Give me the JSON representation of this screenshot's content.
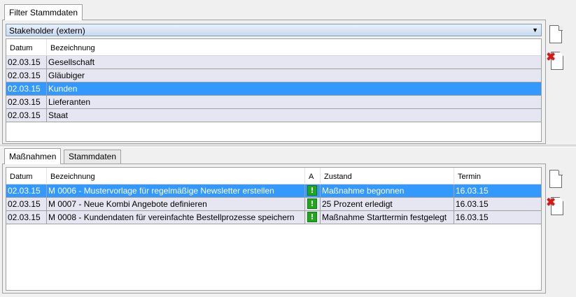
{
  "top_panel": {
    "tab_label": "Filter Stammdaten",
    "filter_value": "Stakeholder (extern)",
    "columns": [
      "Datum",
      "Bezeichnung"
    ],
    "rows": [
      {
        "datum": "02.03.15",
        "bezeichnung": "Gesellschaft"
      },
      {
        "datum": "02.03.15",
        "bezeichnung": "Gläubiger"
      },
      {
        "datum": "02.03.15",
        "bezeichnung": "Kunden"
      },
      {
        "datum": "02.03.15",
        "bezeichnung": "Lieferanten"
      },
      {
        "datum": "02.03.15",
        "bezeichnung": "Staat"
      }
    ],
    "selected_row": 2
  },
  "bottom_panel": {
    "tabs": [
      "Maßnahmen",
      "Stammdaten"
    ],
    "active_tab": 0,
    "columns": [
      "Datum",
      "Bezeichnung",
      "A",
      "Zustand",
      "Termin"
    ],
    "rows": [
      {
        "datum": "02.03.15",
        "bezeichnung": "M 0006 - Mustervorlage für regelmäßige Newsletter erstellen",
        "a": "!",
        "zustand": "Maßnahme begonnen",
        "termin": "16.03.15"
      },
      {
        "datum": "02.03.15",
        "bezeichnung": "M 0007 - Neue Kombi Angebote definieren",
        "a": "!",
        "zustand": "25 Prozent erledigt",
        "termin": "16.03.15"
      },
      {
        "datum": "02.03.15",
        "bezeichnung": "M 0008 - Kundendaten für vereinfachte Bestellprozesse speichern",
        "a": "!",
        "zustand": "Maßnahme Starttermin festgelegt",
        "termin": "16.03.15"
      }
    ],
    "selected_row": 0
  },
  "icons": {
    "new": "new-document-icon",
    "delete": "delete-document-icon",
    "status": "green-exclamation-icon"
  },
  "colors": {
    "selection": "#3399ff",
    "row_background": "#e6e6f2",
    "status_green": "#22a61c",
    "delete_red": "#d81818"
  }
}
